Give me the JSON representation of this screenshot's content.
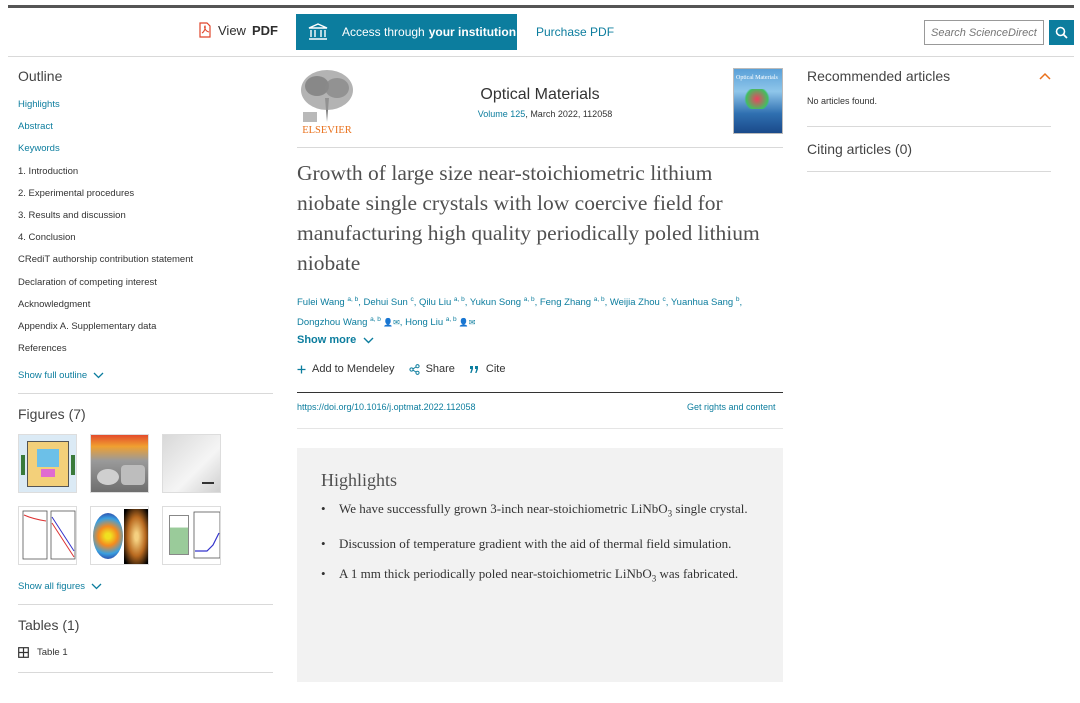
{
  "header": {
    "view_pdf_prefix": "View",
    "view_pdf_bold": "PDF",
    "access_prefix": "Access through",
    "access_bold": "your institution",
    "purchase": "Purchase PDF",
    "search_placeholder": "Search ScienceDirect"
  },
  "outline": {
    "title": "Outline",
    "items": [
      "Highlights",
      "Abstract",
      "Keywords",
      "1. Introduction",
      "2. Experimental procedures",
      "3. Results and discussion",
      "4. Conclusion",
      "CRediT authorship contribution statement",
      "Declaration of competing interest",
      "Acknowledgment",
      "Appendix A. Supplementary data",
      "References"
    ],
    "show_full": "Show full outline"
  },
  "figures": {
    "title": "Figures (7)",
    "show_all": "Show all figures"
  },
  "tables": {
    "title": "Tables (1)",
    "item": "Table 1"
  },
  "journal": {
    "publisher": "ELSEVIER",
    "name": "Optical Materials",
    "volume": "Volume 125",
    "meta_rest": ", March 2022, 112058",
    "cover_text": "Optical Materials"
  },
  "article": {
    "title": "Growth of large size near-stoichiometric lithium niobate single crystals with low coercive field for manufacturing high quality periodically poled lithium niobate",
    "authors": [
      {
        "name": "Fulei Wang",
        "sup": "a, b"
      },
      {
        "name": "Dehui Sun",
        "sup": "c"
      },
      {
        "name": "Qilu Liu",
        "sup": "a, b"
      },
      {
        "name": "Yukun Song",
        "sup": "a, b"
      },
      {
        "name": "Feng Zhang",
        "sup": "a, b"
      },
      {
        "name": "Weijia Zhou",
        "sup": "c"
      },
      {
        "name": "Yuanhua Sang",
        "sup": "b"
      },
      {
        "name": "Dongzhou Wang",
        "sup": "a, b"
      },
      {
        "name": "Hong Liu",
        "sup": "a, b"
      }
    ],
    "show_more": "Show more",
    "actions": {
      "mendeley": "Add to Mendeley",
      "share": "Share",
      "cite": "Cite"
    },
    "doi": "https://doi.org/10.1016/j.optmat.2022.112058",
    "rights": "Get rights and content"
  },
  "highlights": {
    "title": "Highlights",
    "items": [
      {
        "pre": "We have successfully grown 3-inch near-stoichiometric LiNbO",
        "sub": "3",
        "post": " single crystal."
      },
      {
        "pre": "Discussion of temperature gradient with the aid of thermal field simulation.",
        "sub": "",
        "post": ""
      },
      {
        "pre": "A 1 mm thick periodically poled near-stoichiometric LiNbO",
        "sub": "3",
        "post": " was fabricated."
      }
    ]
  },
  "right": {
    "recommended": "Recommended articles",
    "no_articles": "No articles found.",
    "citing": "Citing articles (0)"
  },
  "colors": {
    "accent": "#0c7d9e",
    "elsevier_orange": "#e9711c"
  }
}
